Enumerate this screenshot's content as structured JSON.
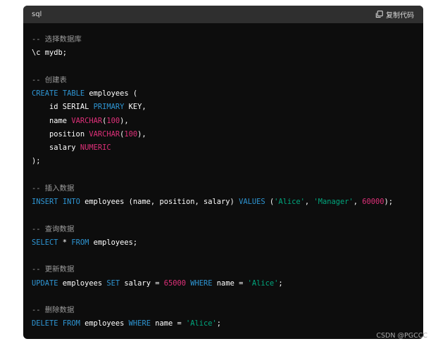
{
  "header": {
    "language": "sql",
    "copy_label": "复制代码",
    "copy_icon": "copy-icon"
  },
  "code": {
    "lines": [
      [
        {
          "t": "comment",
          "v": "-- 选择数据库"
        }
      ],
      [
        {
          "t": "plain",
          "v": "\\c mydb;"
        }
      ],
      [],
      [
        {
          "t": "comment",
          "v": "-- 创建表"
        }
      ],
      [
        {
          "t": "keyword",
          "v": "CREATE"
        },
        {
          "t": "plain",
          "v": " "
        },
        {
          "t": "keyword",
          "v": "TABLE"
        },
        {
          "t": "plain",
          "v": " employees ("
        }
      ],
      [
        {
          "t": "plain",
          "v": "    id SERIAL "
        },
        {
          "t": "keyword",
          "v": "PRIMARY"
        },
        {
          "t": "plain",
          "v": " KEY,"
        }
      ],
      [
        {
          "t": "plain",
          "v": "    name "
        },
        {
          "t": "type",
          "v": "VARCHAR"
        },
        {
          "t": "plain",
          "v": "("
        },
        {
          "t": "number",
          "v": "100"
        },
        {
          "t": "plain",
          "v": "),"
        }
      ],
      [
        {
          "t": "plain",
          "v": "    position "
        },
        {
          "t": "type",
          "v": "VARCHAR"
        },
        {
          "t": "plain",
          "v": "("
        },
        {
          "t": "number",
          "v": "100"
        },
        {
          "t": "plain",
          "v": "),"
        }
      ],
      [
        {
          "t": "plain",
          "v": "    salary "
        },
        {
          "t": "type",
          "v": "NUMERIC"
        }
      ],
      [
        {
          "t": "plain",
          "v": ");"
        }
      ],
      [],
      [
        {
          "t": "comment",
          "v": "-- 插入数据"
        }
      ],
      [
        {
          "t": "keyword",
          "v": "INSERT"
        },
        {
          "t": "plain",
          "v": " "
        },
        {
          "t": "keyword",
          "v": "INTO"
        },
        {
          "t": "plain",
          "v": " employees (name, position, salary) "
        },
        {
          "t": "keyword",
          "v": "VALUES"
        },
        {
          "t": "plain",
          "v": " ("
        },
        {
          "t": "string",
          "v": "'Alice'"
        },
        {
          "t": "plain",
          "v": ", "
        },
        {
          "t": "string",
          "v": "'Manager'"
        },
        {
          "t": "plain",
          "v": ", "
        },
        {
          "t": "number",
          "v": "60000"
        },
        {
          "t": "plain",
          "v": ");"
        }
      ],
      [],
      [
        {
          "t": "comment",
          "v": "-- 查询数据"
        }
      ],
      [
        {
          "t": "keyword",
          "v": "SELECT"
        },
        {
          "t": "plain",
          "v": " * "
        },
        {
          "t": "keyword",
          "v": "FROM"
        },
        {
          "t": "plain",
          "v": " employees;"
        }
      ],
      [],
      [
        {
          "t": "comment",
          "v": "-- 更新数据"
        }
      ],
      [
        {
          "t": "keyword",
          "v": "UPDATE"
        },
        {
          "t": "plain",
          "v": " employees "
        },
        {
          "t": "keyword",
          "v": "SET"
        },
        {
          "t": "plain",
          "v": " salary = "
        },
        {
          "t": "number",
          "v": "65000"
        },
        {
          "t": "plain",
          "v": " "
        },
        {
          "t": "keyword",
          "v": "WHERE"
        },
        {
          "t": "plain",
          "v": " name = "
        },
        {
          "t": "string",
          "v": "'Alice'"
        },
        {
          "t": "plain",
          "v": ";"
        }
      ],
      [],
      [
        {
          "t": "comment",
          "v": "-- 删除数据"
        }
      ],
      [
        {
          "t": "keyword",
          "v": "DELETE"
        },
        {
          "t": "plain",
          "v": " "
        },
        {
          "t": "keyword",
          "v": "FROM"
        },
        {
          "t": "plain",
          "v": " employees "
        },
        {
          "t": "keyword",
          "v": "WHERE"
        },
        {
          "t": "plain",
          "v": " name = "
        },
        {
          "t": "string",
          "v": "'Alice'"
        },
        {
          "t": "plain",
          "v": ";"
        }
      ]
    ]
  },
  "watermark": "CSDN @PGCCC",
  "colors": {
    "background": "#0d0d0d",
    "header": "#2f2f2f",
    "comment": "#9a9a9a",
    "keyword": "#2e95d3",
    "type_number": "#df3079",
    "string": "#00a67d"
  }
}
